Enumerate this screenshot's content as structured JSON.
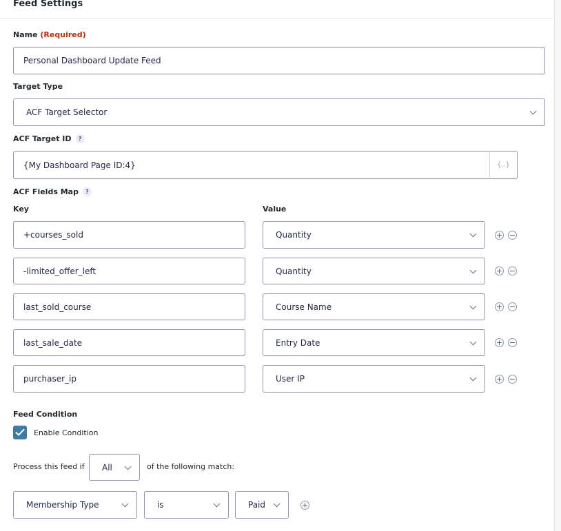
{
  "panel": {
    "title": "Feed Settings"
  },
  "name_field": {
    "label": "Name",
    "required": "(Required)",
    "value": "Personal Dashboard Update Feed"
  },
  "target_type": {
    "label": "Target Type",
    "value": "ACF Target Selector"
  },
  "target_id": {
    "label": "ACF Target ID",
    "help": "?",
    "value": "{My Dashboard Page ID:4}",
    "merge_tag": "{..}"
  },
  "fields_map": {
    "label": "ACF Fields Map",
    "help": "?",
    "key_header": "Key",
    "value_header": "Value",
    "rows": [
      {
        "key": "+courses_sold",
        "value": "Quantity"
      },
      {
        "key": "-limited_offer_left",
        "value": "Quantity"
      },
      {
        "key": "last_sold_course",
        "value": "Course Name"
      },
      {
        "key": "last_sale_date",
        "value": "Entry Date"
      },
      {
        "key": "purchaser_ip",
        "value": "User IP"
      }
    ],
    "add_glyph": "+",
    "remove_glyph": "−"
  },
  "condition": {
    "label": "Feed Condition",
    "enable_label": "Enable Condition",
    "enabled": true,
    "process_prefix": "Process this feed if",
    "logic": "All",
    "process_suffix": "of the following match:",
    "rule": {
      "field": "Membership Type",
      "operator": "is",
      "value": "Paid"
    }
  },
  "colors": {
    "border": "#9092b2",
    "required": "#c02b0a",
    "checkbox": "#3e7ca6"
  }
}
